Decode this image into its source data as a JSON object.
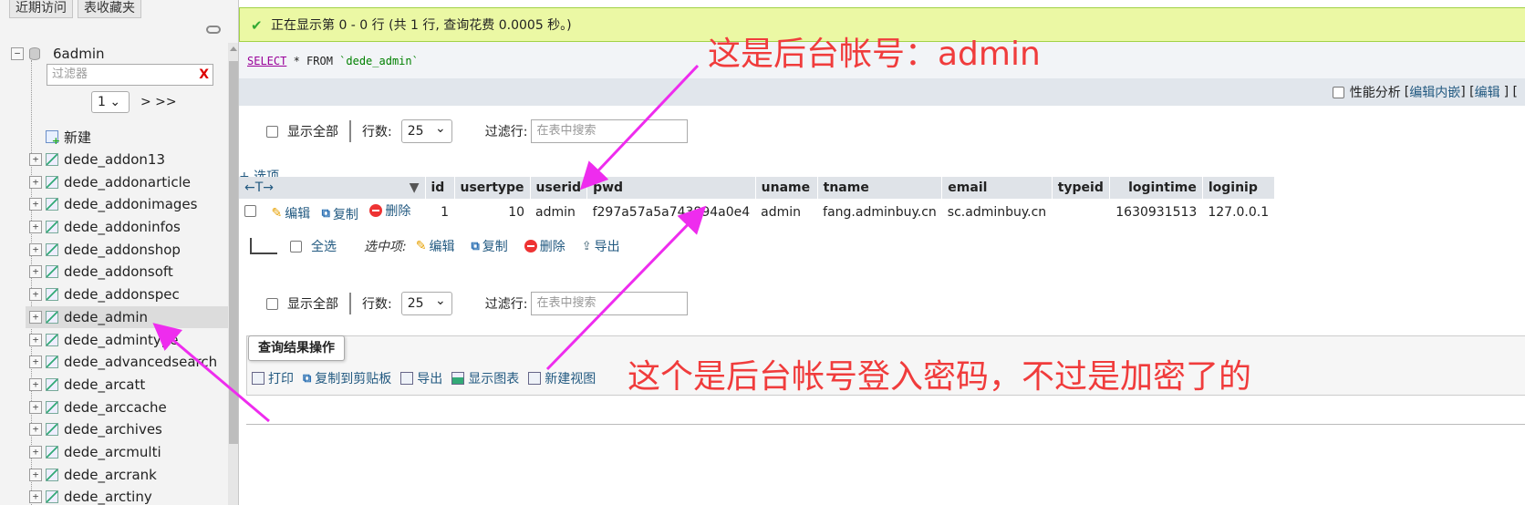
{
  "nav": {
    "top_tabs": [
      "近期访问",
      "表收藏夹"
    ],
    "db_name": "6admin",
    "filter_placeholder": "过滤器",
    "filter_clear": "X",
    "page_select": "1",
    "page_next": "> >>",
    "new_label": "新建",
    "tables": [
      "dede_addon13",
      "dede_addonarticle",
      "dede_addonimages",
      "dede_addoninfos",
      "dede_addonshop",
      "dede_addonsoft",
      "dede_addonspec",
      "dede_admin",
      "dede_admintype",
      "dede_advancedsearch",
      "dede_arcatt",
      "dede_arccache",
      "dede_archives",
      "dede_arcmulti",
      "dede_arcrank",
      "dede_arctiny"
    ],
    "active_table": "dede_admin"
  },
  "main": {
    "success_msg": "正在显示第 0 - 0 行 (共 1 行, 查询花费 0.0005 秒。)",
    "sql": {
      "select": "SELECT",
      "rest": " * FROM ",
      "table": "`dede_admin`"
    },
    "profiling": {
      "label": "性能分析",
      "edit_inline": "编辑内嵌",
      "edit": "编辑",
      "open_bracket": "[",
      "close_bracket": "]",
      "sep": "] [",
      "tail": "["
    },
    "controls": {
      "show_all": "显示全部",
      "rows_label": "行数:",
      "rows_value": "25",
      "filter_label": "过滤行:",
      "filter_placeholder": "在表中搜索"
    },
    "options_link": "+ 选项",
    "sort_arrows": "←T→",
    "columns": [
      "id",
      "usertype",
      "userid",
      "pwd",
      "uname",
      "tname",
      "email",
      "typeid",
      "logintime",
      "loginip"
    ],
    "row_actions": {
      "edit": "编辑",
      "copy": "复制",
      "delete": "删除"
    },
    "rows": [
      {
        "id": "1",
        "usertype": "10",
        "userid": "admin",
        "pwd": "f297a57a5a743894a0e4",
        "uname": "admin",
        "tname": "fang.adminbuy.cn",
        "email": "sc.adminbuy.cn",
        "typeid": "",
        "logintime": "1630931513",
        "loginip": "127.0.0.1"
      }
    ],
    "bulk": {
      "select_all": "全选",
      "with_selected": "选中项:",
      "edit": "编辑",
      "copy": "复制",
      "delete": "删除",
      "export": "导出"
    },
    "query_ops": {
      "legend": "查询结果操作",
      "print": "打印",
      "copy_clipboard": "复制到剪贴板",
      "export": "导出",
      "chart": "显示图表",
      "new_view": "新建视图"
    }
  },
  "annotations": {
    "top": "这是后台帐号：admin",
    "bottom": "这个是后台帐号登入密码，不过是加密了的",
    "color": "#f03c3c",
    "arrow_color": "#ee2cee"
  }
}
